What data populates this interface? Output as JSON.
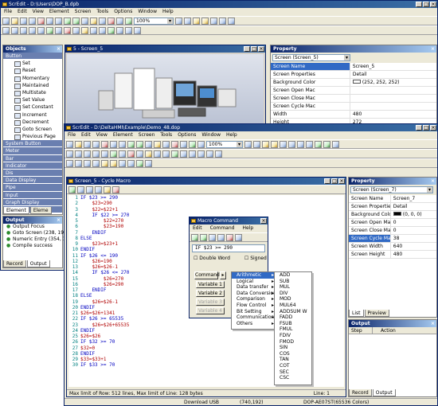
{
  "back_window": {
    "title": "ScrEdit - D:\\Users\\DOP_B.dpb",
    "menu": [
      "File",
      "Edit",
      "View",
      "Element",
      "Screen",
      "Tools",
      "Options",
      "Window",
      "Help"
    ],
    "zoom": "100%",
    "objects_panel": {
      "title": "Objects",
      "items": [
        {
          "label": "Button",
          "category": true
        },
        {
          "label": "Set"
        },
        {
          "label": "Reset"
        },
        {
          "label": "Momentary"
        },
        {
          "label": "Maintained"
        },
        {
          "label": "Multistate"
        },
        {
          "label": "Set Value"
        },
        {
          "label": "Set Constant"
        },
        {
          "label": "Increment"
        },
        {
          "label": "Decrement"
        },
        {
          "label": "Goto Screen"
        },
        {
          "label": "Previous Page"
        },
        {
          "label": "System Button",
          "category": true
        },
        {
          "label": "Meter",
          "category": true
        },
        {
          "label": "Bar",
          "category": true
        },
        {
          "label": "Indicator",
          "category": true
        },
        {
          "label": "Dis",
          "category": true
        },
        {
          "label": "Data Display",
          "category": true
        },
        {
          "label": "Pipe",
          "category": true
        },
        {
          "label": "Input",
          "category": true
        },
        {
          "label": "Graph Display",
          "category": true
        },
        {
          "label": "Curve",
          "category": true
        }
      ],
      "tabs": [
        "Element",
        "Eleme"
      ]
    },
    "output_panel": {
      "title": "Output",
      "lines": [
        "Output Focus",
        "Goto Screen (238, 199)",
        "Numeric Entry (354, 148",
        "Compile success"
      ],
      "tabs": [
        "Record",
        "Output"
      ]
    },
    "screen_window": {
      "title": "5 - Screen_5"
    },
    "property_panel": {
      "title": "Property",
      "selector": "Screen (Screen_5)",
      "rows": [
        {
          "k": "Screen Name",
          "v": "Screen_5"
        },
        {
          "k": "Screen Properties",
          "v": "Detail"
        },
        {
          "k": "Background Color",
          "v": "(252, 252, 252)"
        },
        {
          "k": "Screen Open Mac",
          "v": ""
        },
        {
          "k": "Screen Close Mac",
          "v": ""
        },
        {
          "k": "Screen Cycle Mac",
          "v": ""
        },
        {
          "k": "Width",
          "v": "480"
        },
        {
          "k": "Height",
          "v": "272"
        }
      ]
    }
  },
  "front_window": {
    "title": "ScrEdit - D:\\DeltaHMI\\Example\\Demo_48.dop",
    "menu": [
      "File",
      "Edit",
      "View",
      "Element",
      "Screen",
      "Tools",
      "Options",
      "Window",
      "Help"
    ],
    "zoom": "100%",
    "macro_window": {
      "title": "Screen_5 - Cycle Macro",
      "code": [
        {
          "n": "1",
          "t": "IF $23 >= 290"
        },
        {
          "n": "2",
          "t": "    $23=290"
        },
        {
          "n": "3",
          "t": "    $22=$22+1"
        },
        {
          "n": "4",
          "t": "    IF $22 >= 270"
        },
        {
          "n": "5",
          "t": "        $22=270"
        },
        {
          "n": "6",
          "t": "        $23=190"
        },
        {
          "n": "7",
          "t": "    ENDIF"
        },
        {
          "n": "8",
          "t": "ELSE"
        },
        {
          "n": "9",
          "t": "    $23=$23+1"
        },
        {
          "n": "10",
          "t": "ENDIF"
        },
        {
          "n": "11",
          "t": "IF $26 <= 190"
        },
        {
          "n": "12",
          "t": "    $26=190"
        },
        {
          "n": "13",
          "t": "    $26=$26-1"
        },
        {
          "n": "14",
          "t": "    IF $26 <= 270"
        },
        {
          "n": "15",
          "t": "        $26=270"
        },
        {
          "n": "16",
          "t": "        $26=290"
        },
        {
          "n": "17",
          "t": "    ENDIF"
        },
        {
          "n": "18",
          "t": "ELSE"
        },
        {
          "n": "19",
          "t": "    $26=$26-1"
        },
        {
          "n": "20",
          "t": "ENDIF"
        },
        {
          "n": "21",
          "t": "$26=$26+1341"
        },
        {
          "n": "22",
          "t": "IF $26 >= 65535"
        },
        {
          "n": "23",
          "t": "    $26=$26+65535"
        },
        {
          "n": "24",
          "t": "ENDIF"
        },
        {
          "n": "25",
          "t": "$26=$26"
        },
        {
          "n": "26",
          "t": "IF $32 >= 70"
        },
        {
          "n": "27",
          "t": "$32=0"
        },
        {
          "n": "28",
          "t": "ENDIF"
        },
        {
          "n": "29",
          "t": "$33=$33+1"
        },
        {
          "n": "30",
          "t": "IF $33 >= 70"
        }
      ],
      "status_left": "Max limit of Row: 512 lines, Max limit of Line: 128 bytes",
      "status_right": "Line: 1"
    },
    "macro_dialog": {
      "title": "Macro Command",
      "menu": [
        "Edit",
        "Command",
        "Help"
      ],
      "expression": "IF $23 >= 290",
      "double_word": "Double Word",
      "signed": "Signed",
      "command_label": "Command",
      "variable_buttons": [
        "Variable 1",
        "Variable 2",
        "Variable 3",
        "Variable 4"
      ]
    },
    "command_menu": [
      "Arithmetic",
      "Logical",
      "Data transfer",
      "Data Conversion",
      "Comparison",
      "Flow Control",
      "Bit Setting",
      "Communication",
      "Others"
    ],
    "arith_menu": [
      "ADD",
      "SUB",
      "MUL",
      "DIV",
      "MOD",
      "MUL64",
      "ADDSUM W",
      "FADD",
      "FSUB",
      "FMUL",
      "FDIV",
      "FMOD",
      "SIN",
      "COS",
      "TAN",
      "COT",
      "SEC",
      "CSC"
    ],
    "property_panel": {
      "title": "Property",
      "selector": "Screen (Screen_7)",
      "rows": [
        {
          "k": "Screen Name",
          "v": "Screen_7"
        },
        {
          "k": "Screen Properties",
          "v": "Detail"
        },
        {
          "k": "Background Color",
          "v": "(0, 0, 0)"
        },
        {
          "k": "Screen Open Macro",
          "v": "0"
        },
        {
          "k": "Screen Close Macro",
          "v": "0"
        },
        {
          "k": "Screen Cycle Macro",
          "v": "38"
        },
        {
          "k": "Screen Width",
          "v": "640"
        },
        {
          "k": "Screen Height",
          "v": "480"
        }
      ],
      "tabs": [
        "List",
        "Preview"
      ]
    },
    "output_panel": {
      "title": "Output",
      "columns": [
        "Step",
        "Action"
      ],
      "tabs": [
        "Record",
        "Output"
      ]
    },
    "statusbar": [
      "Download USB",
      "(740,192)",
      "DOP-AE07ST(65536 Colors)"
    ]
  }
}
